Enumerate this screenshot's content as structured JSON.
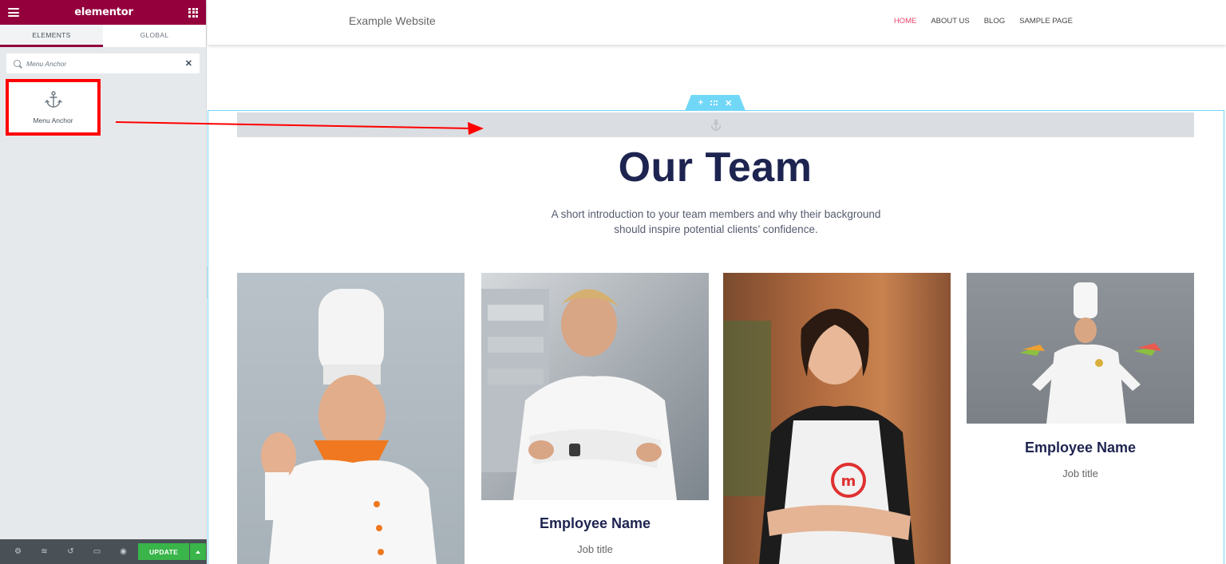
{
  "panel": {
    "brand": "elementor",
    "tabs": [
      "ELEMENTS",
      "GLOBAL"
    ],
    "search": {
      "value": "Menu Anchor",
      "placeholder": "Search Widget..."
    },
    "widget_label": "Menu Anchor",
    "update_label": "UPDATE"
  },
  "site": {
    "title": "Example Website",
    "nav": [
      "HOME",
      "ABOUT US",
      "BLOG",
      "SAMPLE PAGE"
    ]
  },
  "section": {
    "title": "Our Team",
    "subtitle_line1": "A short introduction to your team members and why their background",
    "subtitle_line2": "should inspire potential clients’ confidence."
  },
  "team": [
    {
      "name": "",
      "job": ""
    },
    {
      "name": "Employee Name",
      "job": "Job title"
    },
    {
      "name": "",
      "job": ""
    },
    {
      "name": "Employee Name",
      "job": "Job title"
    }
  ],
  "colors": {
    "elementor_brand": "#93003c",
    "nav_active": "#e5446d",
    "section_outline": "#71d7f7",
    "heading": "#1e2450",
    "update_green": "#39b54a",
    "highlight_red": "#ff0000"
  }
}
